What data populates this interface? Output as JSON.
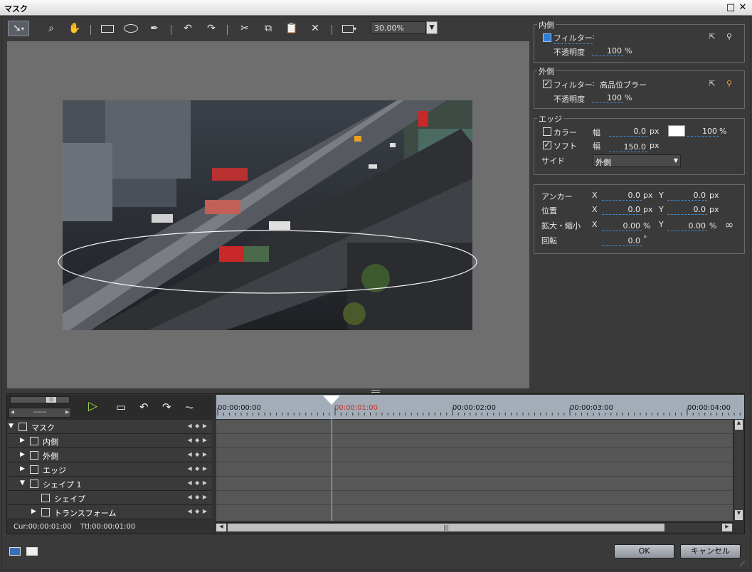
{
  "window": {
    "title": "マスク"
  },
  "toolbar": {
    "zoom": "30.00%",
    "tools": [
      "select-tool",
      "zoom-tool",
      "hand-tool",
      "rectangle-tool",
      "ellipse-tool",
      "pen-tool",
      "undo",
      "redo",
      "cut",
      "copy",
      "paste",
      "delete",
      "fit-view"
    ]
  },
  "inner": {
    "header": "内側",
    "filter_label": "フィルター",
    "filter_colon": ":",
    "filter_value": "",
    "opacity_label": "不透明度",
    "opacity_value": "100",
    "opacity_unit": "%"
  },
  "outer": {
    "header": "外側",
    "filter_label": "フィルター",
    "filter_colon": ":",
    "filter_value": "高品位ブラー",
    "opacity_label": "不透明度",
    "opacity_value": "100",
    "opacity_unit": "%"
  },
  "edge": {
    "header": "エッジ",
    "color_label": "カラー",
    "width_label": "幅",
    "color_width": "0.0",
    "color_width_unit": "px",
    "color_opacity": "100",
    "color_opacity_unit": "%",
    "soft_label": "ソフト",
    "soft_width_label": "幅",
    "soft_width": "150.0",
    "soft_unit": "px",
    "side_label": "サイド",
    "side_value": "外側"
  },
  "transform": {
    "anchor_label": "アンカー",
    "anchor_x": "0.0",
    "anchor_y": "0.0",
    "position_label": "位置",
    "position_x": "0.0",
    "position_y": "0.0",
    "scale_label": "拡大・縮小",
    "scale_x": "0.00",
    "scale_y": "0.00",
    "rotation_label": "回転",
    "rotation": "0.0",
    "rotation_unit": "°",
    "x": "X",
    "y": "Y",
    "px": "px",
    "pct": "%"
  },
  "timeline": {
    "zoom_value": "-----",
    "ruler": [
      "00:00:00:00",
      "00:00:01:00",
      "00:00:02:00",
      "00:00:03:00",
      "00:00:04:00"
    ],
    "tracks": [
      {
        "label": "マスク",
        "level": 0,
        "expanded": true
      },
      {
        "label": "内側",
        "level": 1,
        "expanded": false
      },
      {
        "label": "外側",
        "level": 1,
        "expanded": false
      },
      {
        "label": "エッジ",
        "level": 1,
        "expanded": false
      },
      {
        "label": "シェイプ 1",
        "level": 1,
        "expanded": true
      },
      {
        "label": "シェイプ",
        "level": 2,
        "leaf": true
      },
      {
        "label": "トランスフォーム",
        "level": 2,
        "expanded": false
      }
    ],
    "cur": "Cur:00:00:01:00",
    "ttl": "Ttl:00:00:01:00"
  },
  "buttons": {
    "ok": "OK",
    "cancel": "キャンセル"
  }
}
